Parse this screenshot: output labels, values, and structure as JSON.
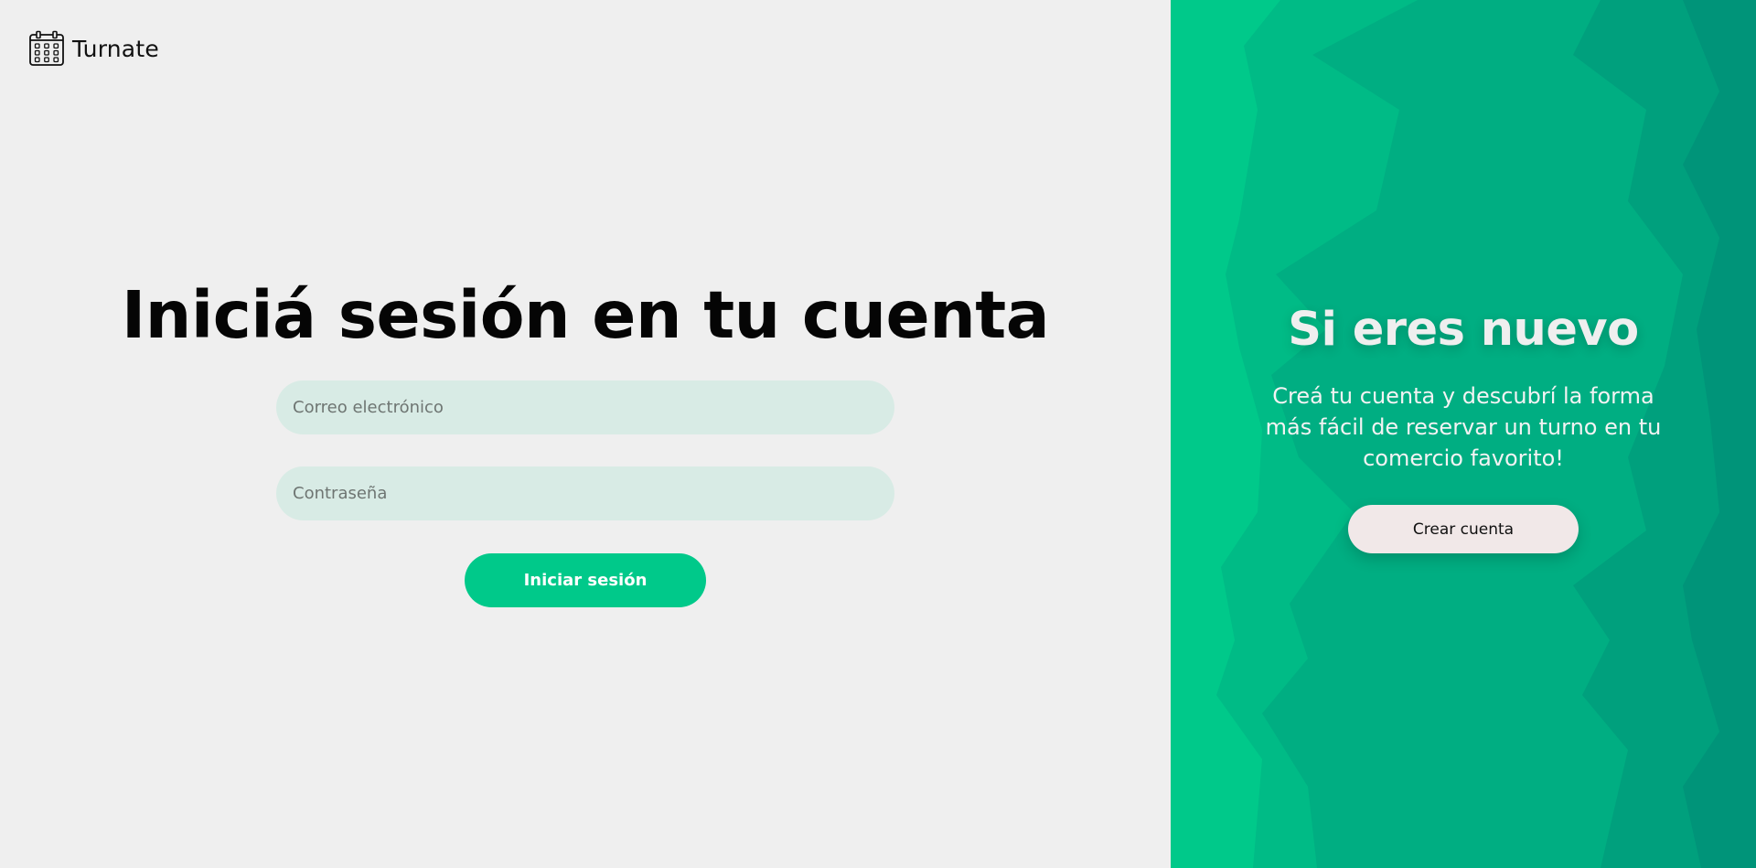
{
  "brand": {
    "name": "Turnate",
    "icon": "calendar-icon"
  },
  "login": {
    "title": "Iniciá sesión en tu cuenta",
    "email_placeholder": "Correo electrónico",
    "password_placeholder": "Contraseña",
    "submit_label": "Iniciar sesión"
  },
  "signup": {
    "title": "Si eres nuevo",
    "text": "Creá tu cuenta y descubrí la forma más fácil de reservar un turno en tu comercio favorito!",
    "button_label": "Crear cuenta"
  },
  "colors": {
    "background": "#efefef",
    "accent": "#00c98a",
    "input_bg": "#d8ebe5",
    "panel_dark": "#009479"
  }
}
